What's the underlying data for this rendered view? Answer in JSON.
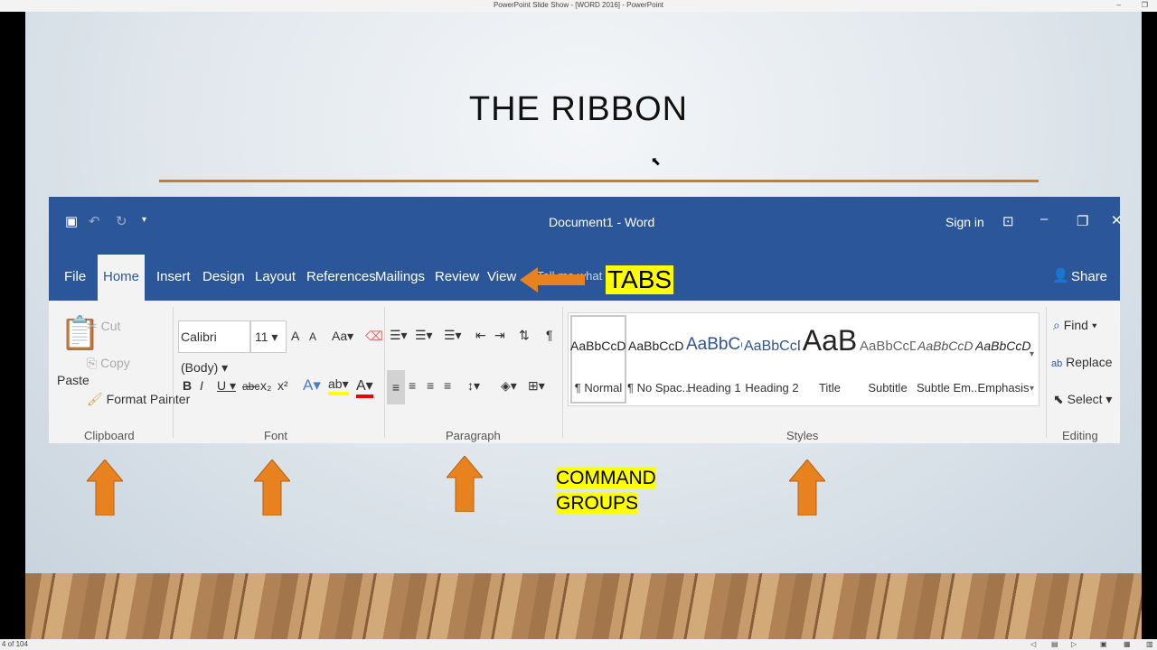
{
  "window": {
    "title": "PowerPoint Slide Show - [WORD 2016] - PowerPoint"
  },
  "slide": {
    "title": "THE RIBBON",
    "tabs_label": "TABS",
    "groups_label_1": "COMMAND",
    "groups_label_2": "GROUPS"
  },
  "word": {
    "doc_title": "Document1 - Word",
    "sign_in": "Sign in",
    "share": "Share",
    "tell_me": "Tell me what y",
    "tabs": [
      "File",
      "Home",
      "Insert",
      "Design",
      "Layout",
      "References",
      "Mailings",
      "Review",
      "View"
    ],
    "clipboard": {
      "paste": "Paste",
      "cut": "Cut",
      "copy": "Copy",
      "format_painter": "Format Painter",
      "group": "Clipboard"
    },
    "font": {
      "name": "Calibri (Body)",
      "size": "11",
      "group": "Font",
      "change_case": "Aa"
    },
    "paragraph": {
      "group": "Paragraph"
    },
    "styles": {
      "group": "Styles",
      "items": [
        {
          "preview": "AaBbCcDc",
          "name": "¶ Normal"
        },
        {
          "preview": "AaBbCcDc",
          "name": "¶ No Spac..."
        },
        {
          "preview": "AaBbCc",
          "name": "Heading 1"
        },
        {
          "preview": "AaBbCcD",
          "name": "Heading 2"
        },
        {
          "preview": "AaB",
          "name": "Title"
        },
        {
          "preview": "AaBbCcD",
          "name": "Subtitle"
        },
        {
          "preview": "AaBbCcDc",
          "name": "Subtle Em..."
        },
        {
          "preview": "AaBbCcDc",
          "name": "Emphasis"
        }
      ]
    },
    "editing": {
      "find": "Find",
      "replace": "Replace",
      "select": "Select",
      "group": "Editing"
    }
  },
  "status": {
    "slide_counter": "4 of 104"
  },
  "colors": {
    "word_blue": "#2b579a",
    "accent_orange": "#e8821e",
    "highlight": "#ffff00"
  }
}
